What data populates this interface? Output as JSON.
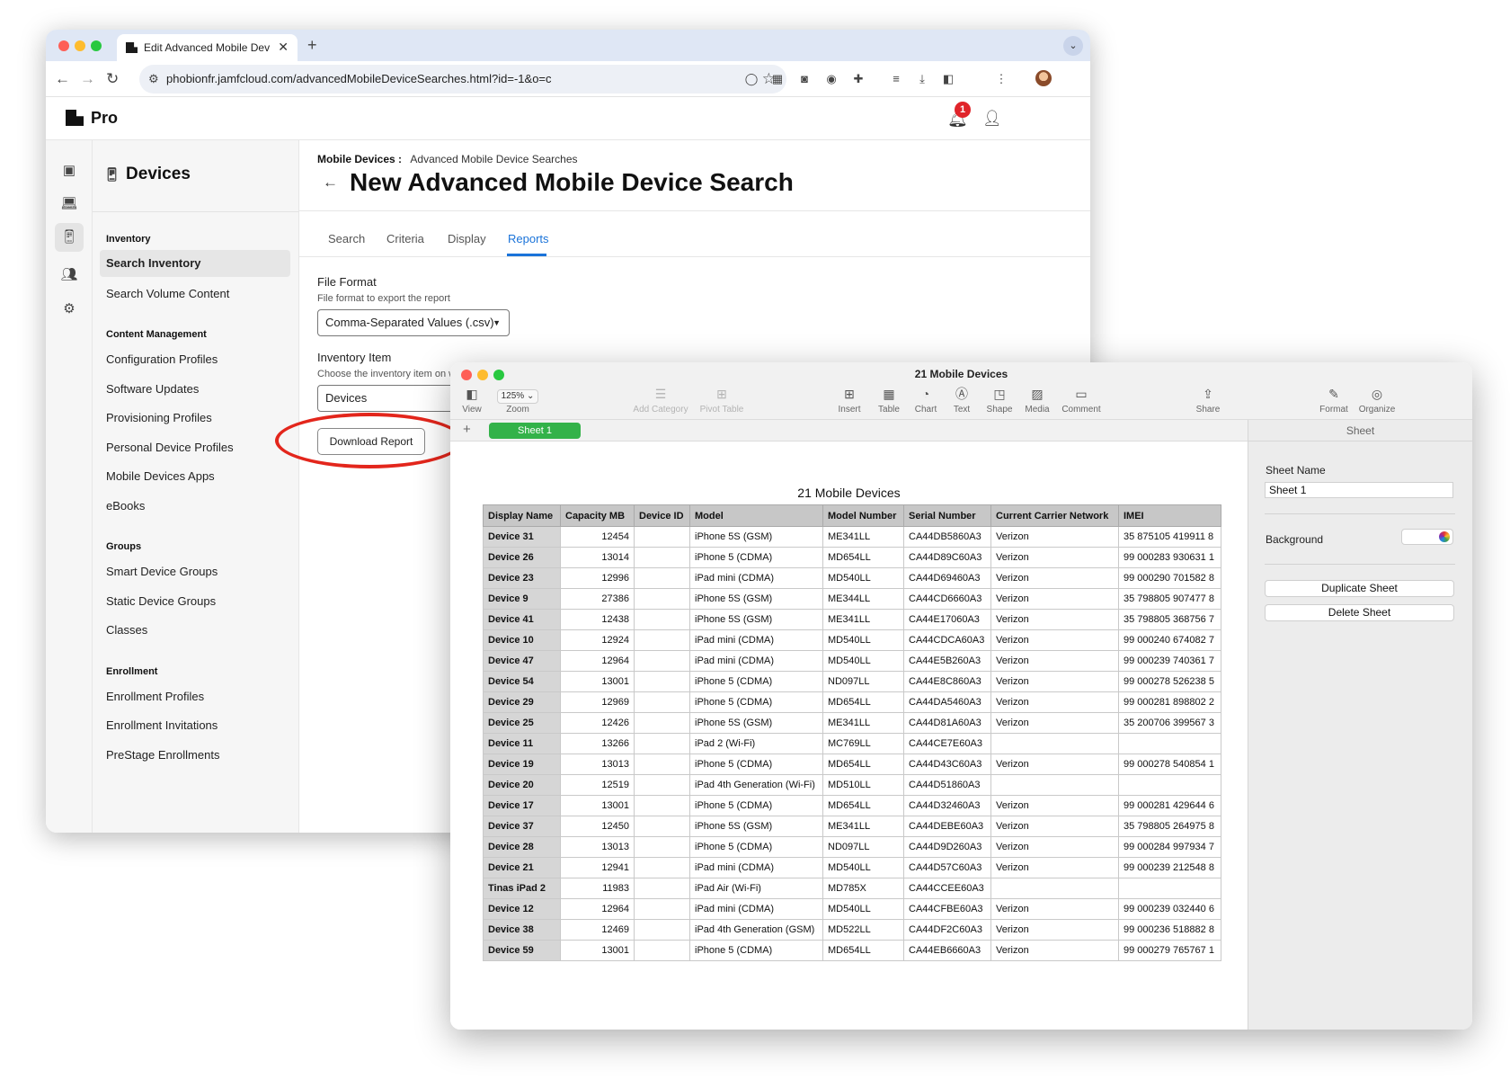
{
  "browser": {
    "tab_title": "Edit Advanced Mobile Device",
    "url": "phobionfr.jamfcloud.com/advancedMobileDeviceSearches.html?id=-1&o=c"
  },
  "jamf": {
    "product": "Pro",
    "notification_count": "1",
    "section_title": "Devices",
    "nav": [
      {
        "type": "heading",
        "label": "Inventory"
      },
      {
        "type": "item",
        "label": "Search Inventory",
        "active": true
      },
      {
        "type": "item",
        "label": "Search Volume Content"
      },
      {
        "type": "heading",
        "label": "Content Management"
      },
      {
        "type": "item",
        "label": "Configuration Profiles"
      },
      {
        "type": "item",
        "label": "Software Updates"
      },
      {
        "type": "item",
        "label": "Provisioning Profiles"
      },
      {
        "type": "item",
        "label": "Personal Device Profiles"
      },
      {
        "type": "item",
        "label": "Mobile Devices Apps"
      },
      {
        "type": "item",
        "label": "eBooks"
      },
      {
        "type": "heading",
        "label": "Groups"
      },
      {
        "type": "item",
        "label": "Smart Device Groups"
      },
      {
        "type": "item",
        "label": "Static Device Groups"
      },
      {
        "type": "item",
        "label": "Classes"
      },
      {
        "type": "heading",
        "label": "Enrollment"
      },
      {
        "type": "item",
        "label": "Enrollment Profiles"
      },
      {
        "type": "item",
        "label": "Enrollment Invitations"
      },
      {
        "type": "item",
        "label": "PreStage Enrollments"
      }
    ],
    "breadcrumb": {
      "parent": "Mobile Devices",
      "separator": ":",
      "current": "Advanced Mobile Device Searches"
    },
    "page_title": "New Advanced Mobile Device Search",
    "tabs": [
      "Search",
      "Criteria",
      "Display",
      "Reports"
    ],
    "active_tab": "Reports",
    "file_format": {
      "label": "File Format",
      "help": "File format to export the report",
      "value": "Comma-Separated Values (.csv)"
    },
    "inventory_item": {
      "label": "Inventory Item",
      "help": "Choose the inventory item on which to",
      "value": "Devices"
    },
    "download_button": "Download Report"
  },
  "numbers": {
    "window_title": "21 Mobile Devices",
    "zoom": "125%",
    "toolbar": [
      {
        "label": "View",
        "icon": "sidebar-icon",
        "enabled": true
      },
      {
        "label": "Zoom",
        "icon": "zoom-icon",
        "enabled": true
      },
      {
        "label": "Add Category",
        "icon": "list-icon",
        "enabled": false
      },
      {
        "label": "Pivot Table",
        "icon": "pivot-icon",
        "enabled": false
      },
      {
        "label": "Insert",
        "icon": "insert-icon",
        "enabled": true
      },
      {
        "label": "Table",
        "icon": "table-icon",
        "enabled": true
      },
      {
        "label": "Chart",
        "icon": "chart-icon",
        "enabled": true
      },
      {
        "label": "Text",
        "icon": "text-icon",
        "enabled": true
      },
      {
        "label": "Shape",
        "icon": "shape-icon",
        "enabled": true
      },
      {
        "label": "Media",
        "icon": "media-icon",
        "enabled": true
      },
      {
        "label": "Comment",
        "icon": "comment-icon",
        "enabled": true
      },
      {
        "label": "Share",
        "icon": "share-icon",
        "enabled": true
      },
      {
        "label": "Format",
        "icon": "format-brush-icon",
        "enabled": true
      },
      {
        "label": "Organize",
        "icon": "organize-icon",
        "enabled": true
      }
    ],
    "sheet_tab": "Sheet 1",
    "table_title": "21 Mobile Devices",
    "columns": [
      "Display Name",
      "Capacity MB",
      "Device ID",
      "Model",
      "Model Number",
      "Serial Number",
      "Current Carrier Network",
      "IMEI"
    ],
    "rows": [
      [
        "Device 31",
        "12454",
        "",
        "iPhone 5S (GSM)",
        "ME341LL",
        "CA44DB5860A3",
        "Verizon",
        "35 875105 419911 8"
      ],
      [
        "Device 26",
        "13014",
        "",
        "iPhone 5 (CDMA)",
        "MD654LL",
        "CA44D89C60A3",
        "Verizon",
        "99 000283 930631 1"
      ],
      [
        "Device 23",
        "12996",
        "",
        "iPad mini (CDMA)",
        "MD540LL",
        "CA44D69460A3",
        "Verizon",
        "99 000290 701582 8"
      ],
      [
        "Device 9",
        "27386",
        "",
        "iPhone 5S (GSM)",
        "ME344LL",
        "CA44CD6660A3",
        "Verizon",
        "35 798805 907477 8"
      ],
      [
        "Device 41",
        "12438",
        "",
        "iPhone 5S (GSM)",
        "ME341LL",
        "CA44E17060A3",
        "Verizon",
        "35 798805 368756 7"
      ],
      [
        "Device 10",
        "12924",
        "",
        "iPad mini (CDMA)",
        "MD540LL",
        "CA44CDCA60A3",
        "Verizon",
        "99 000240 674082 7"
      ],
      [
        "Device 47",
        "12964",
        "",
        "iPad mini (CDMA)",
        "MD540LL",
        "CA44E5B260A3",
        "Verizon",
        "99 000239 740361 7"
      ],
      [
        "Device 54",
        "13001",
        "",
        "iPhone 5 (CDMA)",
        "ND097LL",
        "CA44E8C860A3",
        "Verizon",
        "99 000278 526238 5"
      ],
      [
        "Device 29",
        "12969",
        "",
        "iPhone 5 (CDMA)",
        "MD654LL",
        "CA44DA5460A3",
        "Verizon",
        "99 000281 898802 2"
      ],
      [
        "Device 25",
        "12426",
        "",
        "iPhone 5S (GSM)",
        "ME341LL",
        "CA44D81A60A3",
        "Verizon",
        "35 200706 399567 3"
      ],
      [
        "Device 11",
        "13266",
        "",
        "iPad 2 (Wi-Fi)",
        "MC769LL",
        "CA44CE7E60A3",
        "",
        ""
      ],
      [
        "Device 19",
        "13013",
        "",
        "iPhone 5 (CDMA)",
        "MD654LL",
        "CA44D43C60A3",
        "Verizon",
        "99 000278 540854 1"
      ],
      [
        "Device 20",
        "12519",
        "",
        "iPad 4th Generation (Wi-Fi)",
        "MD510LL",
        "CA44D51860A3",
        "",
        ""
      ],
      [
        "Device 17",
        "13001",
        "",
        "iPhone 5 (CDMA)",
        "MD654LL",
        "CA44D32460A3",
        "Verizon",
        "99 000281 429644 6"
      ],
      [
        "Device 37",
        "12450",
        "",
        "iPhone 5S (GSM)",
        "ME341LL",
        "CA44DEBE60A3",
        "Verizon",
        "35 798805 264975 8"
      ],
      [
        "Device 28",
        "13013",
        "",
        "iPhone 5 (CDMA)",
        "ND097LL",
        "CA44D9D260A3",
        "Verizon",
        "99 000284 997934 7"
      ],
      [
        "Device 21",
        "12941",
        "",
        "iPad mini (CDMA)",
        "MD540LL",
        "CA44D57C60A3",
        "Verizon",
        "99 000239 212548 8"
      ],
      [
        "Tinas iPad 2",
        "11983",
        "",
        "iPad Air (Wi-Fi)",
        "MD785X",
        "CA44CCEE60A3",
        "",
        ""
      ],
      [
        "Device 12",
        "12964",
        "",
        "iPad mini (CDMA)",
        "MD540LL",
        "CA44CFBE60A3",
        "Verizon",
        "99 000239 032440 6"
      ],
      [
        "Device 38",
        "12469",
        "",
        "iPad 4th Generation (GSM)",
        "MD522LL",
        "CA44DF2C60A3",
        "Verizon",
        "99 000236 518882 8"
      ],
      [
        "Device 59",
        "13001",
        "",
        "iPhone 5 (CDMA)",
        "MD654LL",
        "CA44EB6660A3",
        "Verizon",
        "99 000279 765767 1"
      ]
    ],
    "inspector": {
      "header": "Sheet",
      "sheet_name_label": "Sheet Name",
      "sheet_name_value": "Sheet 1",
      "background_label": "Background",
      "duplicate_button": "Duplicate Sheet",
      "delete_button": "Delete Sheet"
    }
  }
}
